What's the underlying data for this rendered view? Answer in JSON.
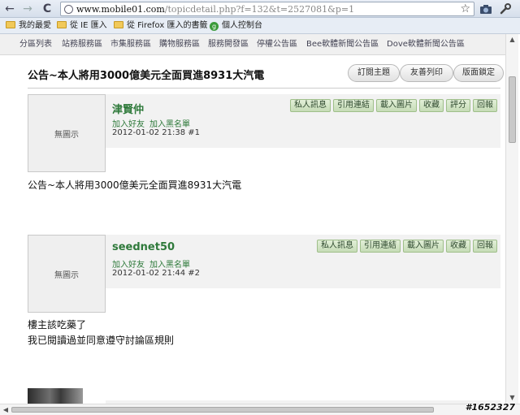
{
  "browser": {
    "url_host": "www.mobile01.com",
    "url_rest": "/topicdetail.php?f=132&t=2527081&p=1",
    "nav": {
      "back": "←",
      "forward": "→",
      "reload": "C"
    },
    "icons": {
      "star": "star-icon",
      "camera": "camera-icon",
      "wrench": "wrench-icon"
    }
  },
  "bookmarks": [
    {
      "label": "我的最愛",
      "icon": "folder-icon"
    },
    {
      "label": "從 IE 匯入",
      "icon": "folder-icon"
    },
    {
      "label": "從 Firefox 匯入的書籤",
      "icon": "folder-icon"
    },
    {
      "label": "個人控制台",
      "icon": "globe-icon"
    }
  ],
  "site_nav": [
    "分區列表",
    "站務服務區",
    "市集服務區",
    "購物服務區",
    "服務開發區",
    "停權公告區",
    "Bee軟體新聞公告區",
    "Dove軟體新聞公告區"
  ],
  "topic": {
    "title": "公告~本人將用3000億美元全面買進8931大汽電",
    "buttons": [
      "訂閱主題",
      "友善列印",
      "版面鎖定"
    ]
  },
  "posts": [
    {
      "avatar_text": "無圖示",
      "username": "津賢仲",
      "links": [
        "加入好友",
        "加入黑名單"
      ],
      "meta": "2012-01-02 21:38 #1",
      "actions": [
        "私人訊息",
        "引用連結",
        "載入圖片",
        "收藏",
        "評分",
        "回報"
      ],
      "body": [
        "公告~本人將用3000億美元全面買進8931大汽電"
      ]
    },
    {
      "avatar_text": "無圖示",
      "username": "seednet50",
      "links": [
        "加入好友",
        "加入黑名單"
      ],
      "meta": "2012-01-02 21:44 #2",
      "actions": [
        "私人訊息",
        "引用連結",
        "載入圖片",
        "收藏",
        "回報"
      ],
      "body": [
        "樓主該吃藥了",
        "我已閱讀過並同意遵守討論區規則"
      ]
    }
  ],
  "watermark": "#1652327"
}
